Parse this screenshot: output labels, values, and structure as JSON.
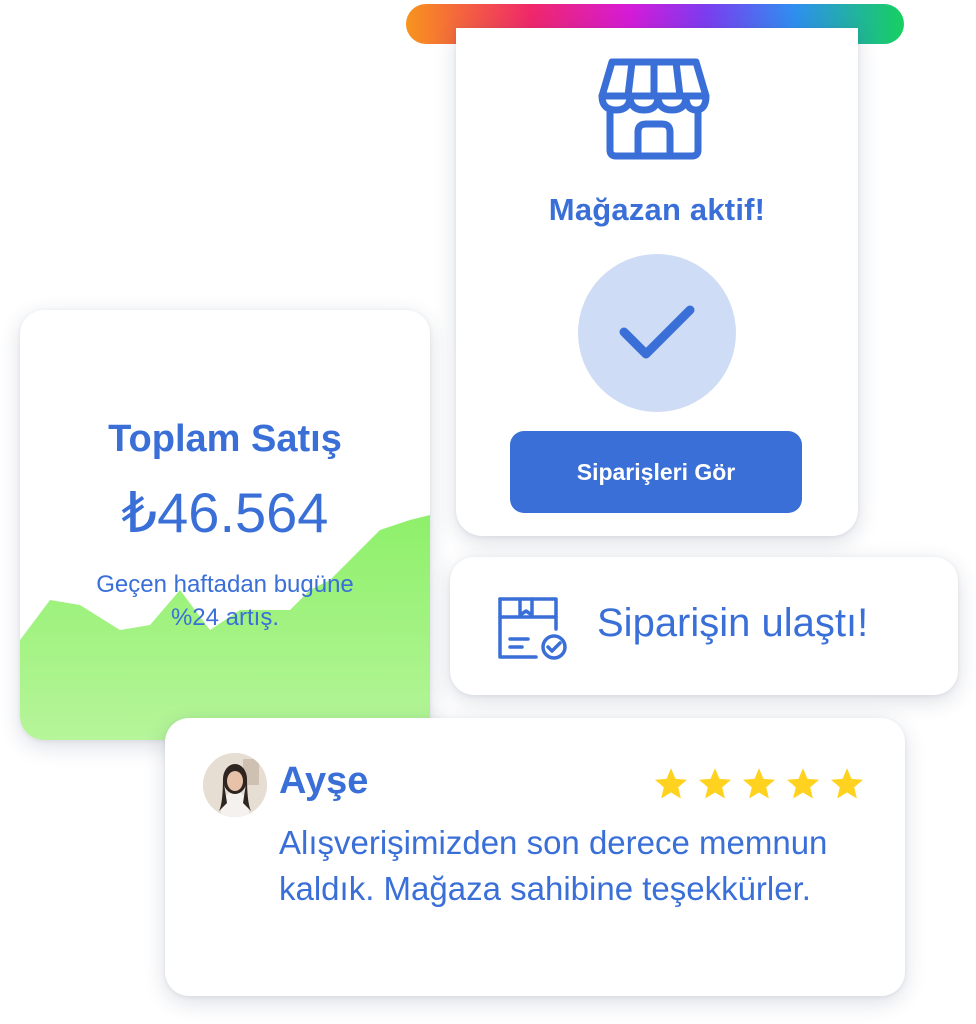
{
  "store": {
    "title": "Mağazan aktif!",
    "button_label": "Siparişleri Gör",
    "icon": "store-icon",
    "check_icon": "checkmark-icon"
  },
  "sales": {
    "title": "Toplam Satış",
    "amount": "₺46.564",
    "note": "Geçen haftadan bugüne %24 artış."
  },
  "order": {
    "message": "Siparişin ulaştı!",
    "icon": "package-check-icon"
  },
  "review": {
    "name": "Ayşe",
    "rating": 5,
    "text": "Alışverişimizden son derece memnun kaldık. Mağaza sahibine teşekkürler."
  },
  "colors": {
    "primary": "#3a6fd8",
    "check_bg": "#cfdcf6",
    "chart_green": "#8ef06a",
    "star": "#ffd21f",
    "gradient": [
      "#f7941d",
      "#f0286a",
      "#d51bd8",
      "#7d3cf0",
      "#2f8ff0",
      "#17d05e"
    ]
  }
}
